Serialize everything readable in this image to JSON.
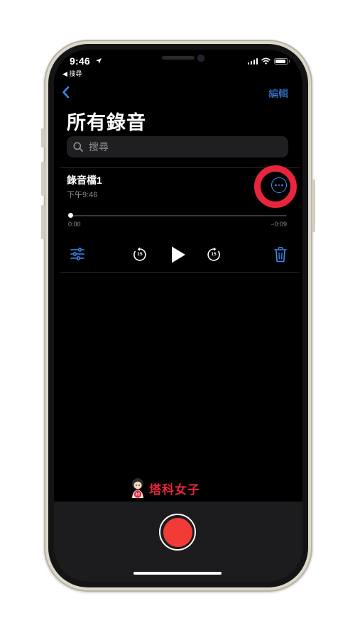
{
  "status_bar": {
    "time": "9:46",
    "back_app_label": "◀ 搜尋",
    "battery_level": 0.85,
    "icons": [
      "location-arrow-icon",
      "cellular-signal-icon",
      "wifi-icon",
      "battery-icon"
    ]
  },
  "nav": {
    "back_icon": "chevron-left-icon",
    "edit_label": "編輯"
  },
  "page": {
    "title": "所有錄音"
  },
  "search": {
    "placeholder": "搜尋",
    "value": "",
    "icon": "search-icon"
  },
  "recording": {
    "name": "錄音檔1",
    "time": "下午9:46",
    "more_icon": "ellipsis-circle-icon",
    "highlight_color": "#e8253d"
  },
  "player": {
    "elapsed": "0:00",
    "remaining": "−0:09",
    "progress": 0.0,
    "skip_back_seconds": "15",
    "skip_forward_seconds": "15",
    "icons": [
      "sliders-icon",
      "skip-back-15-icon",
      "play-icon",
      "skip-forward-15-icon",
      "trash-icon"
    ]
  },
  "watermark": {
    "text": "塔科女子",
    "mascot_badge": "3C"
  },
  "record_button": {
    "icon": "record-icon",
    "color": "#f23b36"
  },
  "colors": {
    "accent": "#3a8df5",
    "background": "#000000",
    "secondary_text": "#8e8e93",
    "bottom_panel": "#1c1c1e"
  }
}
